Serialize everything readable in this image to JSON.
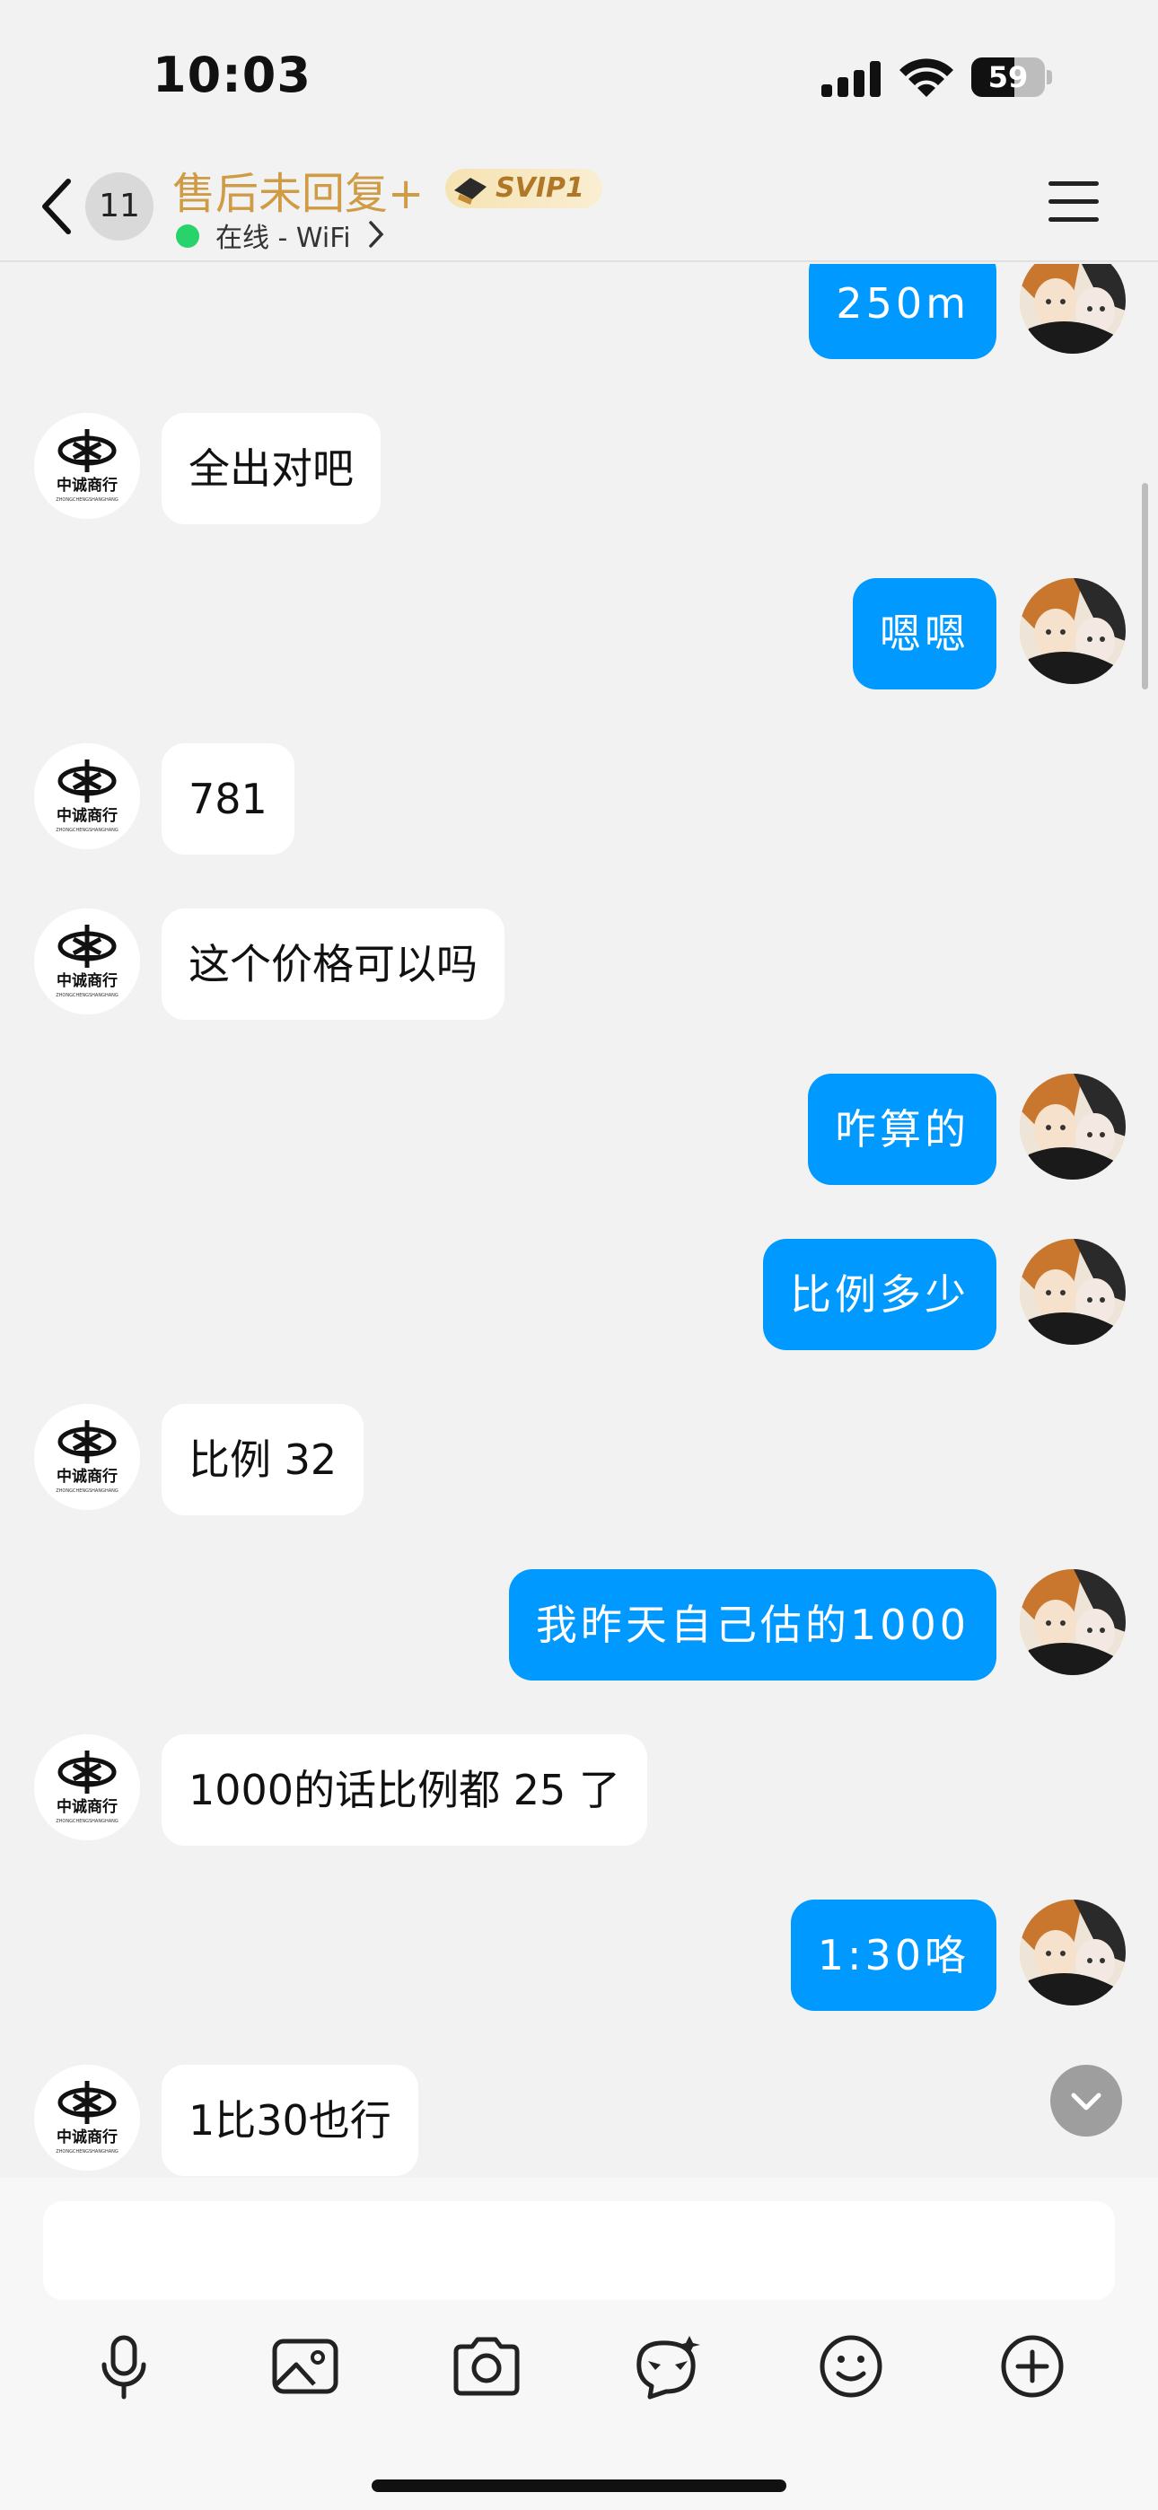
{
  "status_bar": {
    "time": "10:03",
    "battery": "59",
    "battery_level": 0.59
  },
  "header": {
    "back_count": "11",
    "title": "售后未回复+",
    "vip_badge": "SVIP1",
    "online_status": "在线 - WiFi"
  },
  "messages": [
    {
      "side": "out",
      "text": "250m"
    },
    {
      "side": "in",
      "text": "全出对吧"
    },
    {
      "side": "out",
      "text": "嗯嗯"
    },
    {
      "side": "in",
      "text": "781"
    },
    {
      "side": "in",
      "text": "这个价格可以吗"
    },
    {
      "side": "out",
      "text": "咋算的"
    },
    {
      "side": "out",
      "text": "比例多少"
    },
    {
      "side": "in",
      "text": "比例 32"
    },
    {
      "side": "out",
      "text": "我昨天自己估的1000"
    },
    {
      "side": "in",
      "text": "1000的话比例都 25 了"
    },
    {
      "side": "out",
      "text": "1:30咯"
    },
    {
      "side": "in",
      "text": "1比30也行"
    }
  ],
  "contact_avatar": {
    "brand_text": "中诚商行",
    "brand_sub": "ZHONGCHENGSHANGHANG"
  },
  "toolbar": {
    "items": [
      "microphone-icon",
      "image-icon",
      "camera-icon",
      "chat-mask-icon",
      "emoji-icon",
      "plus-icon"
    ]
  },
  "colors": {
    "accent": "#0099ff",
    "title": "#cf9c45",
    "online": "#27d36a"
  }
}
